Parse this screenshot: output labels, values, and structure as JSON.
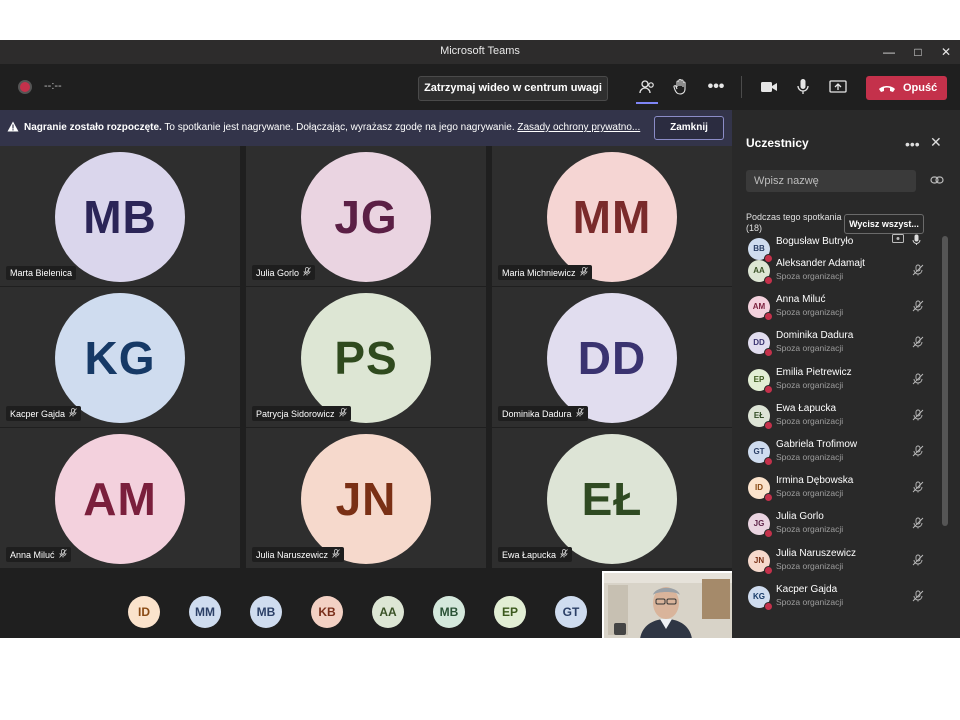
{
  "window": {
    "title": "Microsoft Teams"
  },
  "toolbar": {
    "timer": "--:--",
    "spotlight_label": "Zatrzymaj wideo w centrum uwagi",
    "leave_label": "Opuść"
  },
  "banner": {
    "bold": "Nagranie zostało rozpoczęte.",
    "text": " To spotkanie jest nagrywane. Dołączając, wyrażasz zgodę na jego nagrywanie. ",
    "link": "Zasady ochrony prywatno...",
    "close_label": "Zamknij"
  },
  "tiles": [
    {
      "initials": "MB",
      "name": "Marta Bielenica",
      "bg": "#dad6ec",
      "fg": "#2b2557",
      "muted": false
    },
    {
      "initials": "JG",
      "name": "Julia Gorlo",
      "bg": "#ead4e1",
      "fg": "#5b1f45",
      "muted": true
    },
    {
      "initials": "MM",
      "name": "Maria Michniewicz",
      "bg": "#f5d5d3",
      "fg": "#7a2b2b",
      "muted": true
    },
    {
      "initials": "KG",
      "name": "Kacper Gajda",
      "bg": "#cfdcef",
      "fg": "#163966",
      "muted": true
    },
    {
      "initials": "PS",
      "name": "Patrycja Sidorowicz",
      "bg": "#dde6d4",
      "fg": "#2f4a1e",
      "muted": true
    },
    {
      "initials": "DD",
      "name": "Dominika Dadura",
      "bg": "#e1ddef",
      "fg": "#3a3370",
      "muted": true
    },
    {
      "initials": "AM",
      "name": "Anna Miluć",
      "bg": "#f3d1dd",
      "fg": "#7a1f3c",
      "muted": true
    },
    {
      "initials": "JN",
      "name": "Julia Naruszewicz",
      "bg": "#f6d9cc",
      "fg": "#7a3015",
      "muted": true
    },
    {
      "initials": "EŁ",
      "name": "Ewa Łapucka",
      "bg": "#dde4d6",
      "fg": "#2f4a22",
      "muted": true
    }
  ],
  "bottom_avatars": [
    {
      "initials": "ID",
      "bg": "#fbe3cc",
      "fg": "#8a4a14"
    },
    {
      "initials": "MM",
      "bg": "#cfdcef",
      "fg": "#2b3f66"
    },
    {
      "initials": "MB",
      "bg": "#cfdcef",
      "fg": "#2b3f66"
    },
    {
      "initials": "KB",
      "bg": "#f3d1c4",
      "fg": "#7a2f1b"
    },
    {
      "initials": "AA",
      "bg": "#dde6d4",
      "fg": "#3a5226"
    },
    {
      "initials": "MB",
      "bg": "#d4e8dc",
      "fg": "#2a5236"
    },
    {
      "initials": "EP",
      "bg": "#e2eed4",
      "fg": "#3c5a1d"
    },
    {
      "initials": "GT",
      "bg": "#cfdcef",
      "fg": "#2b3f66"
    }
  ],
  "sidebar": {
    "title": "Uczestnicy",
    "search_placeholder": "Wpisz nazwę",
    "section_label": "Podczas tego spotkania",
    "section_count": "(18)",
    "mute_all_label": "Wycisz wszyst...",
    "participants": [
      {
        "initials": "BB",
        "name": "Bogusław Butryło",
        "sub": "",
        "bg": "#cfdcef",
        "fg": "#2b3f66",
        "self": true
      },
      {
        "initials": "AA",
        "name": "Aleksander Adamajt",
        "sub": "Spoza organizacji",
        "bg": "#dde6d4",
        "fg": "#3a5226"
      },
      {
        "initials": "AM",
        "name": "Anna Miluć",
        "sub": "Spoza organizacji",
        "bg": "#f3d1dd",
        "fg": "#7a1f3c"
      },
      {
        "initials": "DD",
        "name": "Dominika Dadura",
        "sub": "Spoza organizacji",
        "bg": "#e1ddef",
        "fg": "#3a3370"
      },
      {
        "initials": "EP",
        "name": "Emilia Pietrewicz",
        "sub": "Spoza organizacji",
        "bg": "#e2eed4",
        "fg": "#3c5a1d"
      },
      {
        "initials": "EŁ",
        "name": "Ewa Łapucka",
        "sub": "Spoza organizacji",
        "bg": "#dde4d6",
        "fg": "#2f4a22"
      },
      {
        "initials": "GT",
        "name": "Gabriela Trofimow",
        "sub": "Spoza organizacji",
        "bg": "#cfdcef",
        "fg": "#2b3f66"
      },
      {
        "initials": "ID",
        "name": "Irmina Dębowska",
        "sub": "Spoza organizacji",
        "bg": "#fbe3cc",
        "fg": "#8a4a14"
      },
      {
        "initials": "JG",
        "name": "Julia Gorlo",
        "sub": "Spoza organizacji",
        "bg": "#ead4e1",
        "fg": "#5b1f45"
      },
      {
        "initials": "JN",
        "name": "Julia Naruszewicz",
        "sub": "Spoza organizacji",
        "bg": "#f6d9cc",
        "fg": "#7a3015"
      },
      {
        "initials": "KG",
        "name": "Kacper Gajda",
        "sub": "Spoza organizacji",
        "bg": "#cfdcef",
        "fg": "#163966"
      }
    ]
  },
  "colors": {
    "accent_red": "#c4314b",
    "banner_bg": "#33344a",
    "app_bg": "#1f1f1f"
  }
}
